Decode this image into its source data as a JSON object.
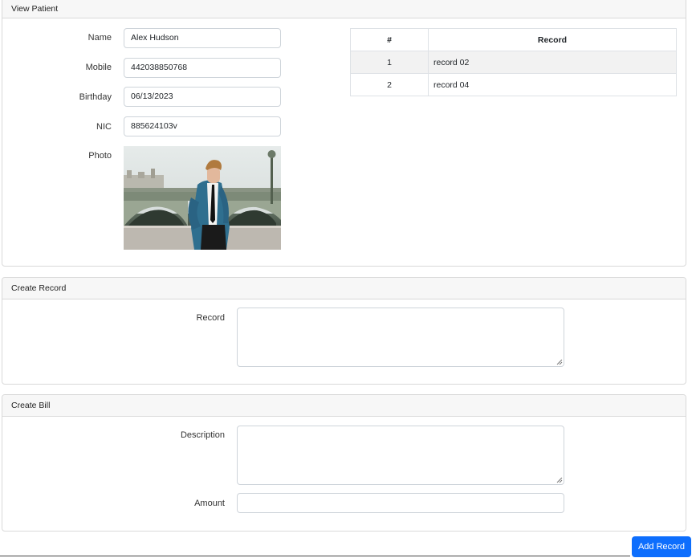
{
  "view_patient": {
    "title": "View Patient",
    "name_label": "Name",
    "name_value": "Alex Hudson",
    "mobile_label": "Mobile",
    "mobile_value": "442038850768",
    "birthday_label": "Birthday",
    "birthday_value": "06/13/2023",
    "nic_label": "NIC",
    "nic_value": "885624103v",
    "photo_label": "Photo"
  },
  "records_table": {
    "headers": [
      "#",
      "Record"
    ],
    "rows": [
      {
        "num": "1",
        "record": "record 02"
      },
      {
        "num": "2",
        "record": "record 04"
      }
    ]
  },
  "create_record": {
    "title": "Create Record",
    "record_label": "Record",
    "record_value": ""
  },
  "create_bill": {
    "title": "Create Bill",
    "description_label": "Description",
    "description_value": "",
    "amount_label": "Amount",
    "amount_value": ""
  },
  "actions": {
    "add_record_label": "Add Record"
  },
  "colors": {
    "primary_button": "#0d6efd",
    "header_bg": "#f7f7f7",
    "border": "#d9d9d9"
  }
}
